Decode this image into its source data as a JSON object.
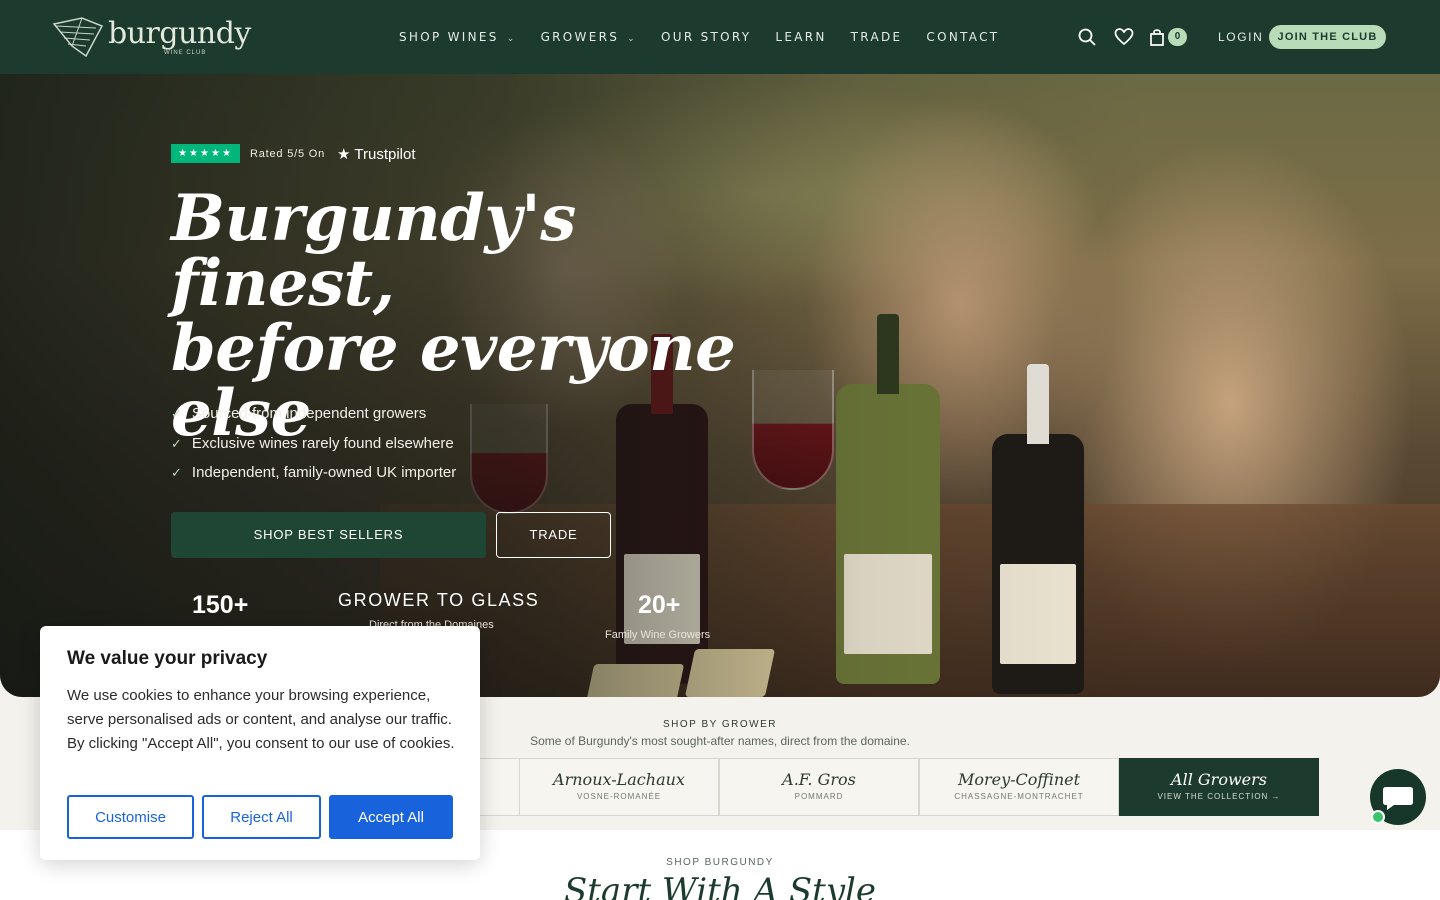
{
  "header": {
    "logo_text": "burgundy",
    "logo_sub": "WINE CLUB",
    "nav": [
      {
        "label": "SHOP WINES",
        "dropdown": true
      },
      {
        "label": "GROWERS",
        "dropdown": true
      },
      {
        "label": "OUR STORY",
        "dropdown": false
      },
      {
        "label": "LEARN",
        "dropdown": false
      },
      {
        "label": "TRADE",
        "dropdown": false
      },
      {
        "label": "CONTACT",
        "dropdown": false
      }
    ],
    "cart_count": "0",
    "login_label": "LOGIN",
    "join_label": "JOIN THE CLUB",
    "icons": [
      "search-icon",
      "heart-icon",
      "bag-icon"
    ]
  },
  "hero": {
    "trustpilot": {
      "stars": "★★★★★",
      "rated": "Rated 5/5 On",
      "brand": "★ Trustpilot"
    },
    "title_lines": [
      "Burgundy's finest,",
      "before everyone",
      "else"
    ],
    "features": [
      "Sourced from independent growers",
      "Exclusive wines rarely found elsewhere",
      "Independent, family-owned UK importer"
    ],
    "tick": "✓",
    "primary_button": "SHOP BEST SELLERS",
    "secondary_button": "TRADE",
    "stats": [
      {
        "value": "150+",
        "label": ""
      },
      {
        "value": "GROWER TO GLASS",
        "label": "Direct from the Domaines"
      },
      {
        "value": "20+",
        "label": "Family Wine Growers"
      }
    ]
  },
  "shop_by_grower": {
    "eyebrow": "SHOP BY GROWER",
    "subtitle": "Some of Burgundy's most sought-after names, direct from the domaine.",
    "growers": [
      {
        "name": "Arnoux-Lachaux",
        "location": "VOSNE-ROMANÉE"
      },
      {
        "name": "A.F. Gros",
        "location": "POMMARD"
      },
      {
        "name": "Morey-Coffinet",
        "location": "CHASSAGNE-MONTRACHET"
      },
      {
        "name": "All Growers",
        "location": "VIEW THE COLLECTION →"
      }
    ]
  },
  "shop_burgundy": {
    "eyebrow": "SHOP BURGUNDY",
    "title": "Start With A Style"
  },
  "cookie": {
    "title": "We value your privacy",
    "body": "We use cookies to enhance your browsing experience, serve personalised ads or content, and analyse our traffic. By clicking \"Accept All\", you consent to our use of cookies.",
    "customise": "Customise",
    "reject": "Reject All",
    "accept": "Accept All"
  },
  "colors": {
    "header_green": "#1c3b2e",
    "accent_mint": "#b9dcb8",
    "trustpilot_green": "#00b67a",
    "cookie_blue": "#1863dc",
    "chat_online": "#3cc46a"
  }
}
